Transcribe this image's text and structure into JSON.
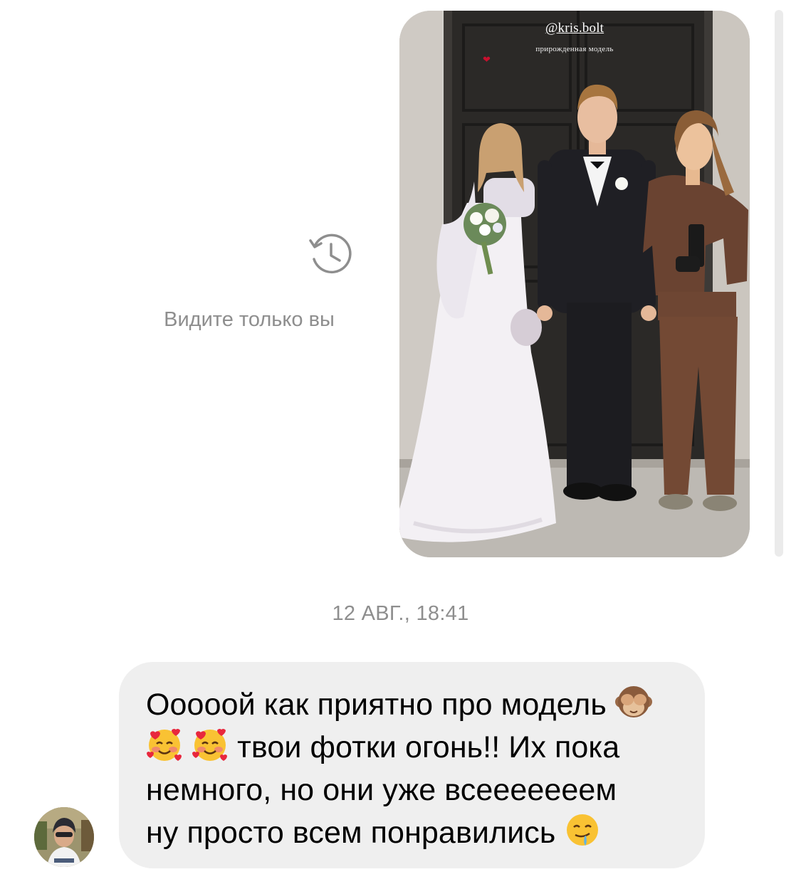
{
  "story": {
    "username": "@kris.bolt",
    "caption": "прирожденная модель",
    "heart": "❤"
  },
  "visibility": {
    "icon": "history-clock-icon",
    "label": "Видите только вы"
  },
  "timestamp": "12 АВГ., 18:41",
  "message": {
    "lines": [
      "Ооооой как приятно про модель",
      "твои фотки огонь!! Их пока",
      "немного, но они уже всееееееем",
      "ну просто всем понравились"
    ],
    "emojis": [
      "see-no-evil-monkey-emoji",
      "smiling-face-with-hearts-emoji",
      "smiling-face-with-hearts-emoji",
      "drooling-face-emoji"
    ]
  },
  "colors": {
    "bubble": "#efefef",
    "muted_text": "#8e8e8e",
    "background": "#ffffff"
  }
}
